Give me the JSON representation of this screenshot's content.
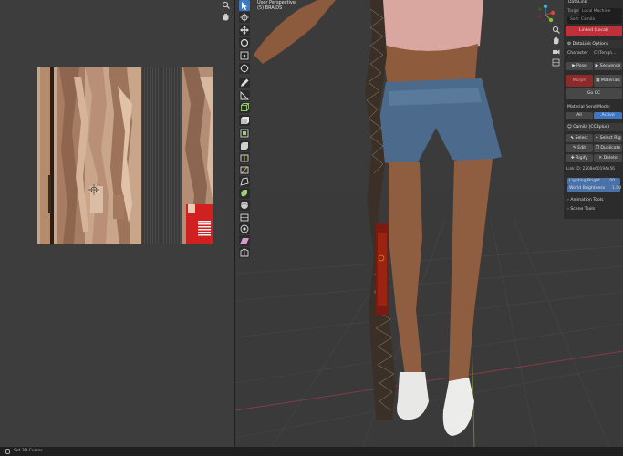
{
  "viewport": {
    "view_label": "User Perspective",
    "object_label": "(5) BRAIDS"
  },
  "npanel": {
    "header": "DataLink",
    "target_label": "Target",
    "target_value": "Local Machine",
    "search_placeholder": "Sort: Camila",
    "linked_button": "Linked (Local)",
    "options_label": "DataLink Options",
    "character_label": "Character",
    "character_path": "C:\\Temp\\...",
    "pose_button": "Pose",
    "sequence_button": "Sequence",
    "morph_button": "Morph",
    "materials_button": "Materials",
    "go_cc_button": "Go CC",
    "material_send_mode_label": "Material Send Mode:",
    "mode_all": "All",
    "mode_active": "Active",
    "object_row": "Camila (CC3plus)",
    "select_button": "Select",
    "select_rig_button": "Select Rig",
    "edit_button": "Edit",
    "duplicate_button": "Duplicate",
    "rigify_button": "Rigify",
    "delete_button": "Delete",
    "link_id": "Link ID: 2208e60194e56",
    "lighting_label": "Lighting Bright...",
    "lighting_value": "1.00",
    "world_label": "World Brightness",
    "world_value": "1.00",
    "animation_tools": "Animation Tools",
    "scene_tools": "Scene Tools"
  },
  "statusbar": {
    "hint": "Set 3D Cursor"
  },
  "colors": {
    "accent_blue": "#3e78c2",
    "linked_red": "#c0303a",
    "uv_skin": "#c9a68a"
  }
}
